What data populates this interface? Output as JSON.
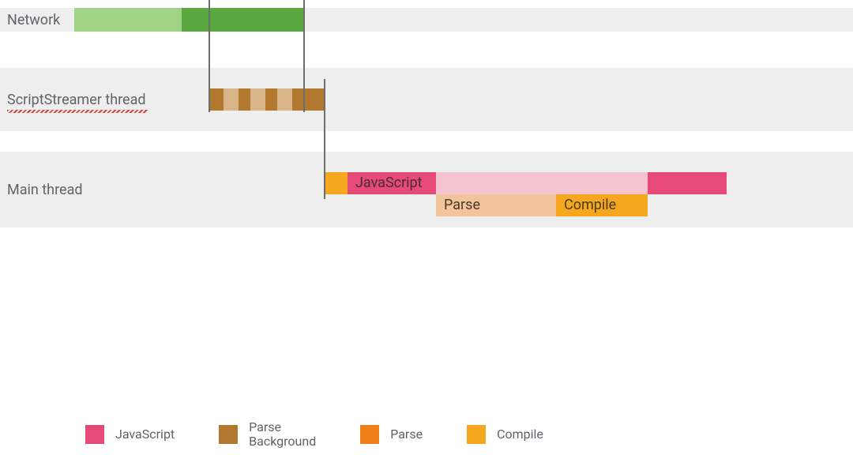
{
  "rows": {
    "network": {
      "label": "Network"
    },
    "scriptstreamer": {
      "label": "ScriptStreamer thread"
    },
    "main": {
      "label": "Main thread"
    }
  },
  "segments": {
    "js_label": "JavaScript",
    "parse_label": "Parse",
    "compile_label": "Compile"
  },
  "legend": {
    "js": {
      "label": "JavaScript",
      "color": "#e64a77"
    },
    "parse_bg": {
      "label": "Parse\nBackground",
      "color": "#b37830"
    },
    "parse": {
      "label": "Parse",
      "color": "#f07f1a"
    },
    "compile": {
      "label": "Compile",
      "color": "#f6a720"
    }
  },
  "colors": {
    "net_light": "#a0d384",
    "net_dark": "#59a840",
    "ss_brown": "#b37830",
    "ss_tan": "#d8b489",
    "mt_pink": "#f4c5d1",
    "mt_peach": "#f2c49b"
  },
  "chart_data": {
    "type": "gantt",
    "unit": "relative-time",
    "lanes": [
      {
        "name": "Network",
        "bars": [
          {
            "kind": "download-early",
            "start": 94,
            "end": 230,
            "color": "net_light"
          },
          {
            "kind": "download-late",
            "start": 230,
            "end": 384,
            "color": "net_dark"
          }
        ]
      },
      {
        "name": "ScriptStreamer thread",
        "bars": [
          {
            "kind": "parse-background-chunked",
            "start": 264,
            "end": 384,
            "color": "ss_brown",
            "stripes_at": [
              283,
              317,
              351
            ]
          },
          {
            "kind": "parse-background-tail",
            "start": 384,
            "end": 410,
            "color": "ss_brown"
          }
        ]
      },
      {
        "name": "Main thread",
        "track": 0,
        "bars": [
          {
            "kind": "compile-prep",
            "start": 410,
            "end": 440,
            "color": "compile"
          },
          {
            "kind": "javascript",
            "start": 440,
            "end": 552,
            "color": "js",
            "label": "JavaScript"
          },
          {
            "kind": "js-idle",
            "start": 552,
            "end": 820,
            "color": "mt_pink"
          },
          {
            "kind": "javascript",
            "start": 820,
            "end": 920,
            "color": "js"
          }
        ]
      },
      {
        "name": "Main thread",
        "track": 1,
        "bars": [
          {
            "kind": "parse",
            "start": 552,
            "end": 704,
            "color": "mt_peach",
            "label": "Parse"
          },
          {
            "kind": "compile",
            "start": 704,
            "end": 820,
            "color": "compile",
            "label": "Compile"
          }
        ]
      }
    ],
    "dividers": [
      264,
      384,
      410
    ]
  }
}
